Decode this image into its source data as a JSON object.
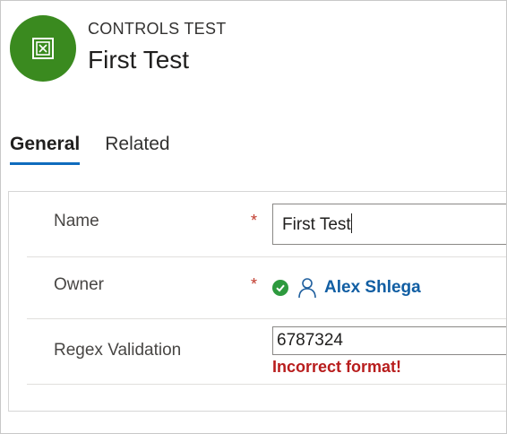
{
  "header": {
    "entity_label": "CONTROLS TEST",
    "record_title": "First Test",
    "avatar_icon": "entity-icon",
    "avatar_color": "#3a8a1f"
  },
  "tabs": [
    {
      "label": "General",
      "active": true
    },
    {
      "label": "Related",
      "active": false
    }
  ],
  "form": {
    "name": {
      "label": "Name",
      "required_marker": "*",
      "value": "First Test"
    },
    "owner": {
      "label": "Owner",
      "required_marker": "*",
      "status_icon": "check-circle-icon",
      "person_icon": "person-icon",
      "value": "Alex Shlega"
    },
    "regex": {
      "label": "Regex Validation",
      "value": "6787324",
      "error": "Incorrect format!",
      "error_color": "#b81d1d"
    }
  }
}
